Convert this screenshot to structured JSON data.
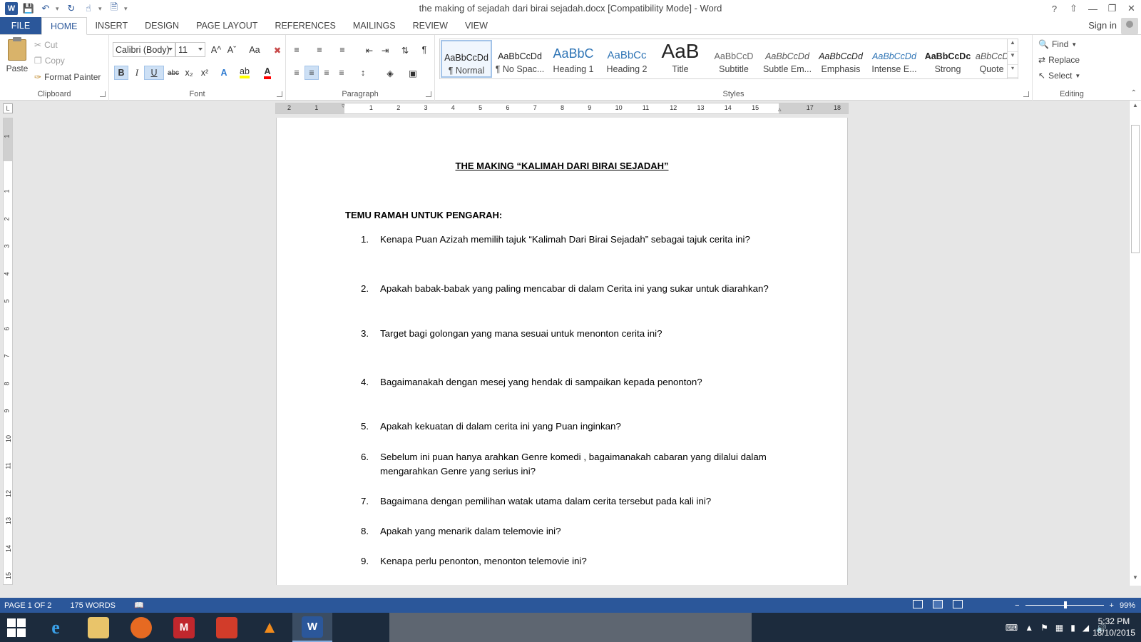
{
  "window": {
    "title": "the making of sejadah dari birai sejadah.docx [Compatibility Mode] - Word",
    "help": "?",
    "signin": "Sign in"
  },
  "tabs": [
    "FILE",
    "HOME",
    "INSERT",
    "DESIGN",
    "PAGE LAYOUT",
    "REFERENCES",
    "MAILINGS",
    "REVIEW",
    "VIEW"
  ],
  "active_tab": "HOME",
  "clipboard": {
    "paste": "Paste",
    "cut": "Cut",
    "copy": "Copy",
    "format_painter": "Format Painter",
    "label": "Clipboard"
  },
  "font": {
    "family": "Calibri (Body)",
    "size": "11",
    "label": "Font",
    "bold": "B",
    "italic": "I",
    "underline": "U",
    "strike": "abc",
    "subscript": "x₂",
    "superscript": "x²",
    "grow": "A^",
    "shrink": "Aˇ",
    "case": "Aa",
    "font_color_accent": "#ff0000",
    "highlight_color": "#ffff00"
  },
  "paragraph": {
    "label": "Paragraph",
    "pilcrow": "¶"
  },
  "styles": {
    "label": "Styles",
    "items": [
      {
        "preview": "AaBbCcDd",
        "name": "¶ Normal"
      },
      {
        "preview": "AaBbCcDd",
        "name": "¶ No Spac..."
      },
      {
        "preview": "AaBbC",
        "name": "Heading 1"
      },
      {
        "preview": "AaBbCc",
        "name": "Heading 2"
      },
      {
        "preview": "AaB",
        "name": "Title"
      },
      {
        "preview": "AaBbCcD",
        "name": "Subtitle"
      },
      {
        "preview": "AaBbCcDd",
        "name": "Subtle Em..."
      },
      {
        "preview": "AaBbCcDd",
        "name": "Emphasis"
      },
      {
        "preview": "AaBbCcDd",
        "name": "Intense E..."
      },
      {
        "preview": "AaBbCcDc",
        "name": "Strong"
      },
      {
        "preview": "AaBbCcDd",
        "name": "Quote"
      }
    ]
  },
  "editing": {
    "label": "Editing",
    "find": "Find",
    "replace": "Replace",
    "select": "Select"
  },
  "ruler": {
    "corner": "L",
    "h_numbers": [
      "2",
      "1",
      "",
      "1",
      "2",
      "3",
      "4",
      "5",
      "6",
      "7",
      "8",
      "9",
      "10",
      "11",
      "12",
      "13",
      "14",
      "15",
      "",
      "17",
      "18"
    ],
    "v_numbers": [
      "1",
      "",
      "1",
      "2",
      "3",
      "4",
      "5",
      "6",
      "7",
      "8",
      "9",
      "10",
      "11",
      "12",
      "13",
      "14",
      "15"
    ]
  },
  "document": {
    "heading": "THE MAKING “KALIMAH DARI BIRAI SEJADAH”",
    "subheading": "TEMU RAMAH UNTUK PENGARAH:",
    "questions": [
      {
        "num": "1.",
        "text": "Kenapa Puan Azizah memilih tajuk “Kalimah Dari Birai Sejadah”  sebagai tajuk cerita ini?"
      },
      {
        "num": "2.",
        "text": "Apakah babak-babak yang paling mencabar di dalam  Cerita ini yang sukar untuk diarahkan?"
      },
      {
        "num": "3.",
        "text": " Target bagi golongan yang mana  sesuai untuk menonton cerita ini?"
      },
      {
        "num": "4.",
        "text": " Bagaimanakah dengan mesej yang hendak di sampaikan kepada penonton?"
      },
      {
        "num": "5.",
        "text": "Apakah kekuatan di dalam cerita ini yang Puan inginkan?"
      },
      {
        "num": "6.",
        "text": "Sebelum ini puan hanya arahkan Genre komedi , bagaimanakah cabaran yang dilalui dalam mengarahkan Genre yang serius ini?"
      },
      {
        "num": "7.",
        "text": "Bagaimana dengan pemilihan watak utama dalam cerita tersebut pada kali ini?"
      },
      {
        "num": "8.",
        "text": "Apakah yang menarik dalam telemovie ini?"
      },
      {
        "num": "9.",
        "text": "Kenapa  perlu penonton, menonton telemovie ini?"
      }
    ]
  },
  "statusbar": {
    "page": "PAGE 1 OF 2",
    "words": "175 WORDS",
    "zoom": "99%",
    "zoom_level_percent": 99,
    "color": "#2b579a"
  },
  "taskbar": {
    "apps": [
      "internet-explorer-icon",
      "file-explorer-icon",
      "firefox-icon",
      "mcafee-icon",
      "app-icon",
      "vlc-icon",
      "word-icon"
    ],
    "mcafee_letter": "M",
    "word_letter": "W",
    "time": "5:32 PM",
    "date": "18/10/2015"
  }
}
